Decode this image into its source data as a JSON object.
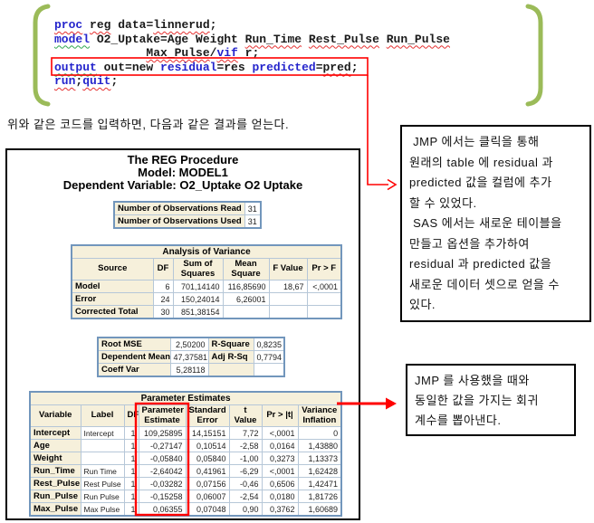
{
  "code": {
    "lines": [
      [
        "proc",
        " ",
        "reg",
        " data=",
        "linnerud",
        ";"
      ],
      [
        "model",
        " O2_Uptake=Age Weight ",
        "Run_Time",
        " ",
        "Rest_Pulse",
        " ",
        "Run_Pulse"
      ],
      [
        "             ",
        "Max_Pulse",
        "/",
        "vif",
        " r;"
      ],
      [
        "output",
        " out=new ",
        "residual",
        "=res ",
        "predicted",
        "=",
        "pred",
        ";"
      ],
      [
        "run",
        ";",
        "quit",
        ";"
      ]
    ]
  },
  "intro_text": "위와 같은 코드를 입력하면, 다음과 같은 결과를 얻는다.",
  "output": {
    "titles": [
      "The REG Procedure",
      "Model: MODEL1",
      "Dependent Variable: O2_Uptake O2 Uptake"
    ],
    "observations": {
      "rows": [
        {
          "label": "Number of Observations Read",
          "value": "31"
        },
        {
          "label": "Number of Observations Used",
          "value": "31"
        }
      ]
    },
    "anova": {
      "title": "Analysis of Variance",
      "headers": [
        "Source",
        "DF",
        "Sum of Squares",
        "Mean Square",
        "F Value",
        "Pr > F"
      ],
      "rows": [
        {
          "source": "Model",
          "df": "6",
          "ss": "701,14140",
          "ms": "116,85690",
          "f": "18,67",
          "p": "<,0001"
        },
        {
          "source": "Error",
          "df": "24",
          "ss": "150,24014",
          "ms": "6,26001",
          "f": "",
          "p": ""
        },
        {
          "source": "Corrected Total",
          "df": "30",
          "ss": "851,38154",
          "ms": "",
          "f": "",
          "p": ""
        }
      ]
    },
    "fit": {
      "rows": [
        {
          "l1": "Root MSE",
          "v1": "2,50200",
          "l2": "R-Square",
          "v2": "0,8235"
        },
        {
          "l1": "Dependent Mean",
          "v1": "47,37581",
          "l2": "Adj R-Sq",
          "v2": "0,7794"
        },
        {
          "l1": "Coeff Var",
          "v1": "5,28118",
          "l2": "",
          "v2": ""
        }
      ]
    },
    "params": {
      "title": "Parameter Estimates",
      "headers": [
        "Variable",
        "Label",
        "DF",
        "Parameter Estimate",
        "Standard Error",
        "t Value",
        "Pr > |t|",
        "Variance Inflation"
      ],
      "rows": [
        {
          "variable": "Intercept",
          "label": "Intercept",
          "df": "1",
          "est": "109,25895",
          "se": "14,15151",
          "t": "7,72",
          "p": "<,0001",
          "vif": "0"
        },
        {
          "variable": "Age",
          "label": "",
          "df": "1",
          "est": "-0,27147",
          "se": "0,10514",
          "t": "-2,58",
          "p": "0,0164",
          "vif": "1,43880"
        },
        {
          "variable": "Weight",
          "label": "",
          "df": "1",
          "est": "-0,05840",
          "se": "0,05840",
          "t": "-1,00",
          "p": "0,3273",
          "vif": "1,13373"
        },
        {
          "variable": "Run_Time",
          "label": "Run Time",
          "df": "1",
          "est": "-2,64042",
          "se": "0,41961",
          "t": "-6,29",
          "p": "<,0001",
          "vif": "1,62428"
        },
        {
          "variable": "Rest_Pulse",
          "label": "Rest Pulse",
          "df": "1",
          "est": "-0,03282",
          "se": "0,07156",
          "t": "-0,46",
          "p": "0,6506",
          "vif": "1,42471"
        },
        {
          "variable": "Run_Pulse",
          "label": "Run Pulse",
          "df": "1",
          "est": "-0,15258",
          "se": "0,06007",
          "t": "-2,54",
          "p": "0,0180",
          "vif": "1,81726"
        },
        {
          "variable": "Max_Pulse",
          "label": "Max Pulse",
          "df": "1",
          "est": "0,06355",
          "se": "0,07048",
          "t": "0,90",
          "p": "0,3762",
          "vif": "1,60689"
        }
      ]
    }
  },
  "annotations": {
    "box1_lines": [
      " JMP 에서는 클릭을 통해",
      "원래의 table 에 residual 과",
      "predicted 값을 컬럼에 추가",
      "할 수 있었다.",
      " SAS 에서는 새로운 테이블을",
      "만들고 옵션을 추가하여",
      "residual 과 predicted 값을",
      "새로운 데이터 셋으로 얻을 수",
      "있다."
    ],
    "box2_lines": [
      "JMP 를 사용했을 때와",
      "동일한 값을 가지는 회귀",
      "계수를 뽑아낸다."
    ]
  },
  "colors": {
    "accent_red": "#FF0000",
    "brace_green": "#9BBB59",
    "keyword_blue": "#2424CC",
    "header_beige": "#F6F0DB",
    "table_border_blue": "#7296BC"
  }
}
